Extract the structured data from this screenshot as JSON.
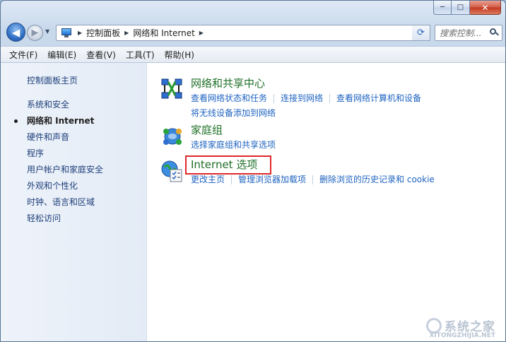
{
  "window": {
    "caption": {
      "minimize": "─",
      "maximize": "□",
      "close": "✕"
    }
  },
  "nav": {
    "back_glyph": "◀",
    "forward_glyph": "▶",
    "breadcrumb": [
      "控制面板",
      "网络和 Internet"
    ],
    "search_placeholder": "搜索控制...",
    "refresh_glyph": "⟳"
  },
  "menu": [
    "文件(F)",
    "编辑(E)",
    "查看(V)",
    "工具(T)",
    "帮助(H)"
  ],
  "sidebar": {
    "home": "控制面板主页",
    "items": [
      {
        "label": "系统和安全",
        "current": false
      },
      {
        "label": "网络和 Internet",
        "current": true
      },
      {
        "label": "硬件和声音",
        "current": false
      },
      {
        "label": "程序",
        "current": false
      },
      {
        "label": "用户帐户和家庭安全",
        "current": false
      },
      {
        "label": "外观和个性化",
        "current": false
      },
      {
        "label": "时钟、语言和区域",
        "current": false
      },
      {
        "label": "轻松访问",
        "current": false
      }
    ]
  },
  "categories": [
    {
      "title": "网络和共享中心",
      "icon": "network-center-icon",
      "links": [
        "查看网络状态和任务",
        "连接到网络",
        "查看网络计算机和设备"
      ],
      "links2": [
        "将无线设备添加到网络"
      ]
    },
    {
      "title": "家庭组",
      "icon": "homegroup-icon",
      "links": [
        "选择家庭组和共享选项"
      ]
    },
    {
      "title": "Internet 选项",
      "icon": "internet-options-icon",
      "links": [
        "更改主页",
        "管理浏览器加载项",
        "删除浏览的历史记录和 cookie"
      ]
    }
  ],
  "watermark": {
    "text": "系统之家",
    "url": "XITONGZHIJIA.NET"
  },
  "colors": {
    "link": "#1e63c0",
    "category_title": "#1f6f27",
    "highlight": "#e0282a",
    "sidebar_bg": "#e8eff8"
  }
}
